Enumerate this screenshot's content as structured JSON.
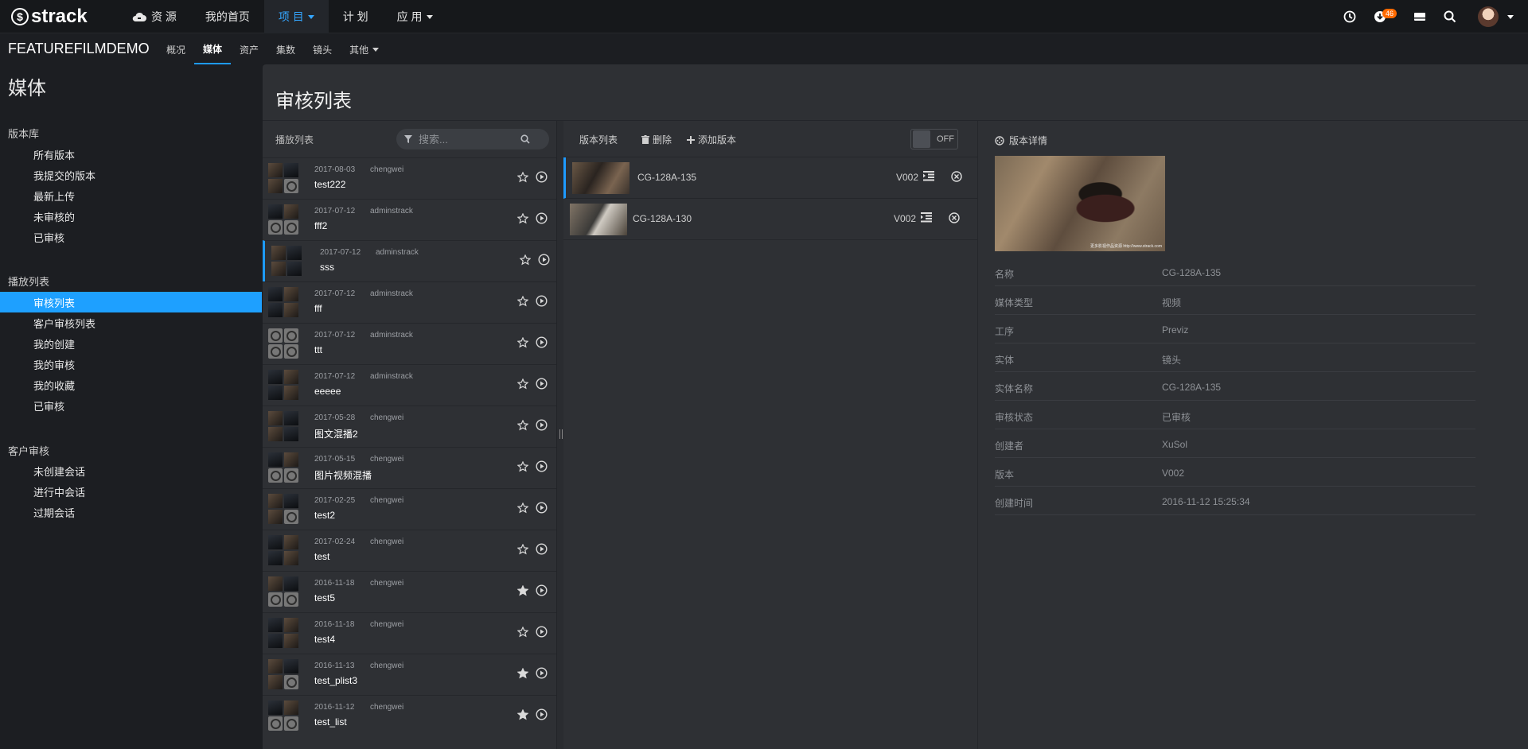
{
  "topnav": {
    "logo": "strack",
    "items": [
      {
        "label": "资 源",
        "icon": "cloud-icon"
      },
      {
        "label": "我的首页"
      },
      {
        "label": "项 目",
        "dropdown": true
      },
      {
        "label": "计 划"
      },
      {
        "label": "应 用",
        "dropdown": true
      }
    ],
    "badge_count": "46"
  },
  "project": {
    "name": "FEATUREFILMDEMO",
    "tabs": [
      "概况",
      "媒体",
      "资产",
      "集数",
      "镜头",
      "其他"
    ],
    "active_tab": "媒体"
  },
  "sidebar": {
    "title": "媒体",
    "groups": [
      {
        "label": "版本库",
        "items": [
          "所有版本",
          "我提交的版本",
          "最新上传",
          "未审核的",
          "已审核"
        ]
      },
      {
        "label": "播放列表",
        "items": [
          "审核列表",
          "客户审核列表",
          "我的创建",
          "我的审核",
          "我的收藏",
          "已审核"
        ]
      },
      {
        "label": "客户审核",
        "items": [
          "未创建会话",
          "进行中会话",
          "过期会话"
        ]
      }
    ],
    "active_item": "审核列表"
  },
  "main": {
    "title": "审核列表",
    "playlist": {
      "label": "播放列表",
      "search_placeholder": "搜索...",
      "rows": [
        {
          "date": "2017-08-03",
          "user": "chengwei",
          "name": "test222",
          "starred": false
        },
        {
          "date": "2017-07-12",
          "user": "adminstrack",
          "name": "fff2",
          "starred": false
        },
        {
          "date": "2017-07-12",
          "user": "adminstrack",
          "name": "sss",
          "starred": false
        },
        {
          "date": "2017-07-12",
          "user": "adminstrack",
          "name": "fff",
          "starred": false
        },
        {
          "date": "2017-07-12",
          "user": "adminstrack",
          "name": "ttt",
          "starred": false
        },
        {
          "date": "2017-07-12",
          "user": "adminstrack",
          "name": "eeeee",
          "starred": false
        },
        {
          "date": "2017-05-28",
          "user": "chengwei",
          "name": "图文混播2",
          "starred": false
        },
        {
          "date": "2017-05-15",
          "user": "chengwei",
          "name": "图片视频混播",
          "starred": false
        },
        {
          "date": "2017-02-25",
          "user": "chengwei",
          "name": "test2",
          "starred": false
        },
        {
          "date": "2017-02-24",
          "user": "chengwei",
          "name": "test",
          "starred": false
        },
        {
          "date": "2016-11-18",
          "user": "chengwei",
          "name": "test5",
          "starred": true
        },
        {
          "date": "2016-11-18",
          "user": "chengwei",
          "name": "test4",
          "starred": false
        },
        {
          "date": "2016-11-13",
          "user": "chengwei",
          "name": "test_plist3",
          "starred": true
        },
        {
          "date": "2016-11-12",
          "user": "chengwei",
          "name": "test_list",
          "starred": true
        }
      ],
      "active_index": 2
    },
    "versions": {
      "toolbar": {
        "list_label": "版本列表",
        "delete_label": "删除",
        "add_label": "添加版本",
        "toggle_label": "OFF"
      },
      "rows": [
        {
          "name": "CG-128A-135",
          "version": "V002"
        },
        {
          "name": "CG-128A-130",
          "version": "V002"
        }
      ]
    },
    "details": {
      "title": "版本详情",
      "preview_caption": "更多影视作品资源 http://www.strack.com",
      "fields": [
        {
          "k": "名称",
          "v": "CG-128A-135"
        },
        {
          "k": "媒体类型",
          "v": "视频"
        },
        {
          "k": "工序",
          "v": "Previz"
        },
        {
          "k": "实体",
          "v": "镜头"
        },
        {
          "k": "实体名称",
          "v": "CG-128A-135"
        },
        {
          "k": "审核状态",
          "v": "已审核"
        },
        {
          "k": "创建者",
          "v": "XuSol"
        },
        {
          "k": "版本",
          "v": "V002"
        },
        {
          "k": "创建时间",
          "v": "2016-11-12 15:25:34"
        }
      ]
    }
  },
  "colors": {
    "accent": "#1ea0ff",
    "badge": "#ff6a00"
  }
}
